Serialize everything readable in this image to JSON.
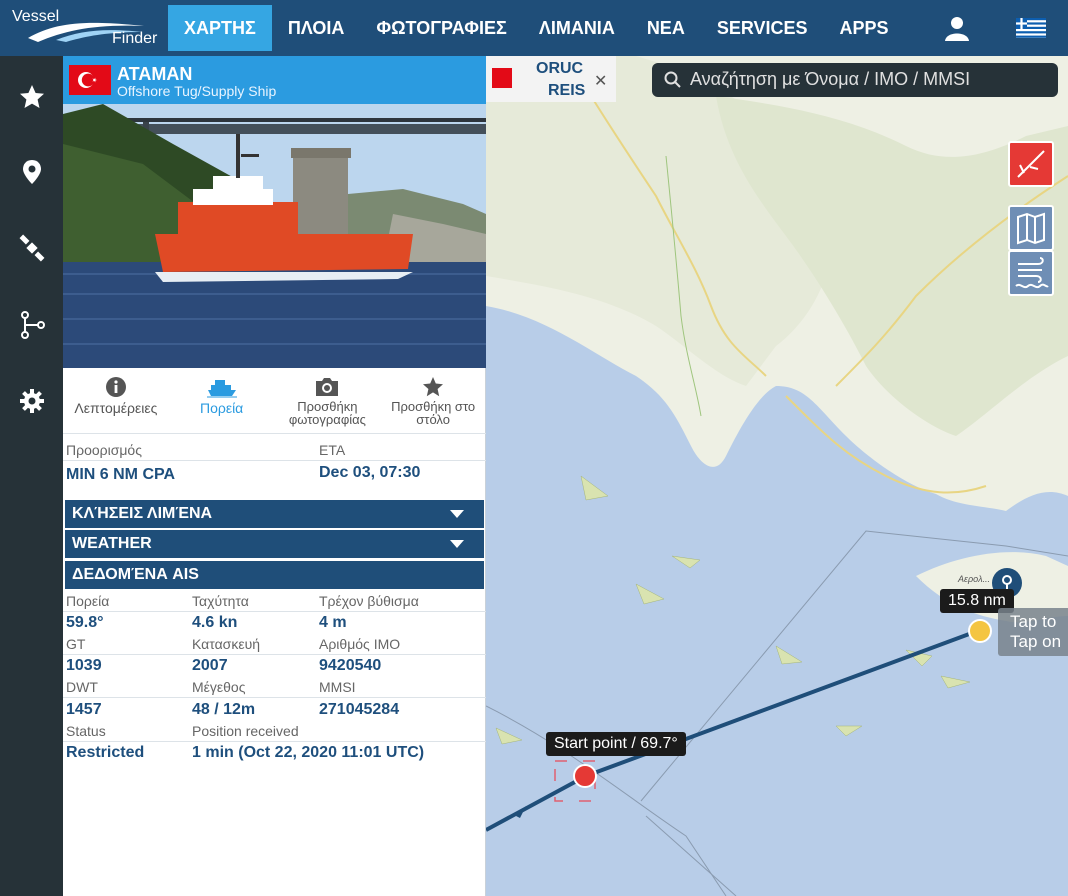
{
  "brand": {
    "line1": "Vessel",
    "line2": "Finder"
  },
  "nav": {
    "items": [
      "ΧΑΡΤΗΣ",
      "ΠΛΟΙΑ",
      "ΦΩΤΟΓΡΑΦΙΕΣ",
      "ΛΙΜΑΝΙΑ",
      "ΝΕΑ",
      "SERVICES",
      "APPS"
    ],
    "active_index": 0
  },
  "ship": {
    "name": "ATAMAN",
    "type": "Offshore Tug/Supply Ship",
    "flag_country": "Turkey"
  },
  "actions": [
    {
      "label": "Λεπτομέρειες",
      "icon": "info-icon"
    },
    {
      "label": "Πορεία",
      "icon": "ship-route-icon",
      "active": true
    },
    {
      "label": "Προσθήκη φωτογραφίας",
      "icon": "camera-icon"
    },
    {
      "label": "Προσθήκη στο στόλο",
      "icon": "star-icon"
    }
  ],
  "voyage": {
    "dest_label": "Προορισμός",
    "dest_value": "MIN 6 NM CPA",
    "eta_label": "ETA",
    "eta_value": "Dec 03, 07:30"
  },
  "sections": {
    "port_calls": "ΚΛΉΣΕΙΣ ΛΙΜΈΝΑ",
    "weather": "WEATHER",
    "ais": "ΔΕΔΟΜΈΝΑ AIS"
  },
  "ais": {
    "course_label": "Πορεία",
    "course_value": "59.8°",
    "speed_label": "Ταχύτητα",
    "speed_value": "4.6 kn",
    "draught_label": "Τρέχον βύθισμα",
    "draught_value": "4 m",
    "gt_label": "GT",
    "gt_value": "1039",
    "built_label": "Κατασκευή",
    "built_value": "2007",
    "imo_label": "Αριθμός IMO",
    "imo_value": "9420540",
    "dwt_label": "DWT",
    "dwt_value": "1457",
    "size_label": "Μέγεθος",
    "size_value": "48 / 12m",
    "mmsi_label": "MMSI",
    "mmsi_value": "271045284",
    "status_label": "Status",
    "status_value": "Restricted",
    "pos_label": "Position received",
    "pos_value": "1 min (Oct 22, 2020 11:01 UTC)"
  },
  "map": {
    "tab_label_1": "ORUC",
    "tab_label_2": "REIS",
    "search_placeholder": "Αναζήτηση με Όνομα / IMO / MMSI",
    "start_label": "Start point / 69.7°",
    "distance_label": "15.8 nm",
    "tap_line1": "Tap to",
    "tap_line2": "Tap on",
    "place_small": "Αερολ...",
    "colors": {
      "sea": "#b8cde8",
      "land": "#eef0e4",
      "route": "#1f4e79",
      "start": "#e53935",
      "end": "#f4c542"
    }
  }
}
